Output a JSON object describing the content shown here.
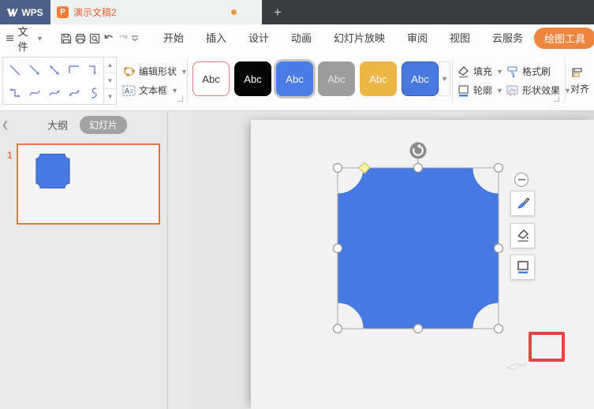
{
  "titlebar": {
    "brand": "WPS",
    "doc_title": "演示文稿2",
    "new_tab": "+"
  },
  "menubar": {
    "file_label": "文件",
    "tabs": [
      "开始",
      "插入",
      "设计",
      "动画",
      "幻灯片放映",
      "审阅",
      "视图",
      "云服务"
    ],
    "tool_tab": "绘图工具"
  },
  "toolbar": {
    "edit_shape": "编辑形状",
    "text_box": "文本框",
    "presets": [
      {
        "label": "Abc",
        "fill": "#ffffff",
        "text": "#333333",
        "border": "#e0807a",
        "selected": false
      },
      {
        "label": "Abc",
        "fill": "#050505",
        "text": "#ffffff",
        "border": "#050505",
        "selected": false
      },
      {
        "label": "Abc",
        "fill": "#4a7ce6",
        "text": "#ffffff",
        "border": "#4a7ce6",
        "selected": true
      },
      {
        "label": "Abc",
        "fill": "#9d9d9d",
        "text": "#e3e3e3",
        "border": "#9d9d9d",
        "selected": false
      },
      {
        "label": "Abc",
        "fill": "#ecb544",
        "text": "#ffffff",
        "border": "#ecb544",
        "selected": false
      },
      {
        "label": "Abc",
        "fill": "#4678de",
        "text": "#ffffff",
        "border": "#2f5cb8",
        "selected": false
      }
    ],
    "fill_label": "填充",
    "outline_label": "轮廓",
    "format_painter_label": "格式刷",
    "shape_effects_label": "形状效果",
    "align_label": "对齐"
  },
  "sidebar": {
    "outline_tab": "大纲",
    "slides_tab": "幻灯片",
    "slide_number": "1"
  },
  "canvas": {
    "shape_fill": "#4679e2",
    "thumb_shape_stroke": "#3d66c0",
    "annotation_color": "#e84343"
  },
  "icons": {
    "brand": "wps-logo",
    "quick": [
      "save-icon",
      "print-icon",
      "print-preview-icon",
      "undo-icon",
      "redo-icon",
      "more-chevron-icon"
    ],
    "floating": [
      "minus-icon",
      "brush-icon",
      "fill-bucket-icon",
      "border-style-icon"
    ],
    "selection": [
      "rotate-handle-icon",
      "adjust-diamond-icon"
    ]
  },
  "colors": {
    "accent_orange": "#ee8640",
    "titlebar_dark": "#383c43",
    "brand_blue": "#4b5f88",
    "selection_handle_stroke": "#969696"
  }
}
